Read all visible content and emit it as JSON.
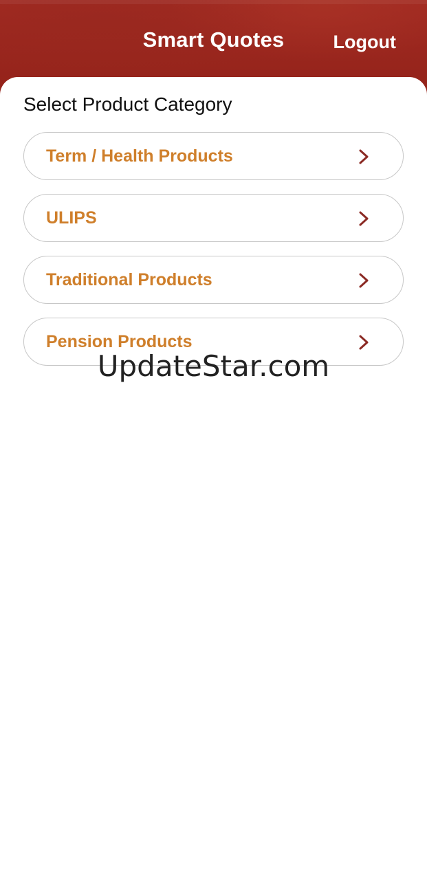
{
  "header": {
    "title": "Smart Quotes",
    "logout_label": "Logout",
    "background_color": "#9b271e"
  },
  "main": {
    "section_title": "Select Product Category",
    "categories": [
      {
        "label": "Term / Health Products",
        "icon": "chevron-right-icon"
      },
      {
        "label": "ULIPS",
        "icon": "chevron-right-icon"
      },
      {
        "label": "Traditional Products",
        "icon": "chevron-right-icon"
      },
      {
        "label": "Pension Products",
        "icon": "chevron-right-icon"
      }
    ],
    "label_color": "#cf7f2b",
    "chevron_color": "#8b2a24"
  },
  "watermark": "UpdateStar.com"
}
